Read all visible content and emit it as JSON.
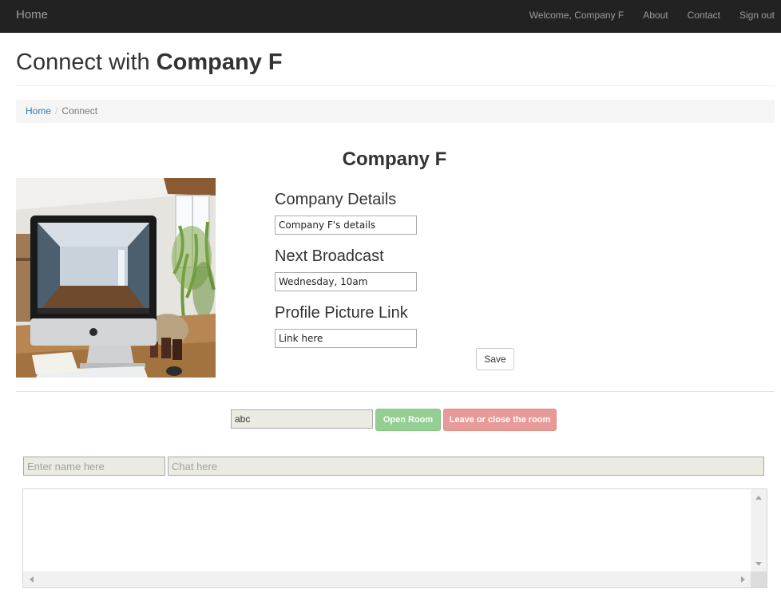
{
  "nav": {
    "brand": "Home",
    "welcome": "Welcome, Company F",
    "about": "About",
    "contact": "Contact",
    "signout": "Sign out"
  },
  "heading": {
    "prefix": "Connect with",
    "company": "Company F"
  },
  "breadcrumb": {
    "home": "Home",
    "separator": "/",
    "current": "Connect"
  },
  "profile": {
    "title": "Company F",
    "details_label": "Company Details",
    "details_value": "Company F's details",
    "broadcast_label": "Next Broadcast",
    "broadcast_value": "Wednesday, 10am",
    "picture_label": "Profile Picture Link",
    "picture_value": "Link here",
    "save_label": "Save"
  },
  "room": {
    "room_value": "abc",
    "open_label": "Open Room",
    "leave_label": "Leave or close the room"
  },
  "chat": {
    "name_placeholder": "Enter name here",
    "message_placeholder": "Chat here",
    "log": ""
  },
  "colors": {
    "navbar": "#222222",
    "link": "#337ab7",
    "open_button": "#93cf93",
    "leave_button": "#e89a98"
  }
}
